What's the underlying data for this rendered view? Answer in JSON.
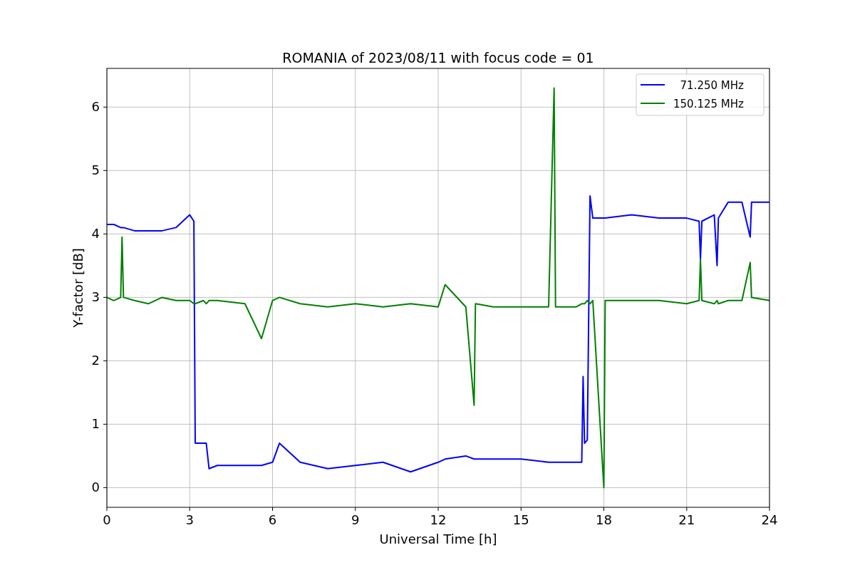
{
  "figure": {
    "chart_data": {
      "type": "line",
      "title": "ROMANIA of 2023/08/11 with focus code = 01",
      "xlabel": "Universal Time [h]",
      "ylabel": "Y-factor [dB]",
      "x": [
        0,
        0.25,
        0.5,
        0.55,
        0.6,
        1,
        1.5,
        2,
        2.5,
        3,
        3.15,
        3.2,
        3.5,
        3.6,
        3.7,
        4,
        5,
        5.6,
        6,
        6.25,
        7,
        8,
        9,
        10,
        11,
        12,
        12.25,
        13,
        13.3,
        13.35,
        14,
        15,
        16,
        16.2,
        16.25,
        17,
        17.2,
        17.25,
        17.3,
        17.4,
        17.5,
        17.6,
        18,
        18.05,
        19,
        20,
        21,
        21.45,
        21.5,
        21.55,
        22,
        22.1,
        22.15,
        22.5,
        23,
        23.3,
        23.35,
        24
      ],
      "series": [
        {
          "name": "  71.250 MHz",
          "color": "#0000ff",
          "values": [
            4.15,
            4.15,
            4.1,
            4.1,
            4.1,
            4.05,
            4.05,
            4.05,
            4.1,
            4.3,
            4.2,
            0.7,
            0.7,
            0.7,
            0.3,
            0.35,
            0.35,
            0.35,
            0.4,
            0.7,
            0.4,
            0.3,
            0.35,
            0.4,
            0.25,
            0.4,
            0.45,
            0.5,
            0.45,
            0.45,
            0.45,
            0.45,
            0.4,
            0.4,
            0.4,
            0.4,
            0.4,
            1.75,
            0.7,
            0.75,
            4.6,
            4.25,
            4.25,
            4.25,
            4.3,
            4.25,
            4.25,
            4.2,
            3.6,
            4.2,
            4.3,
            3.5,
            4.25,
            4.5,
            4.5,
            3.95,
            4.5,
            4.5
          ]
        },
        {
          "name": "150.125 MHz",
          "color": "#008000",
          "values": [
            3.0,
            2.95,
            3.0,
            3.95,
            3.0,
            2.95,
            2.9,
            3.0,
            2.95,
            2.95,
            2.9,
            2.9,
            2.95,
            2.9,
            2.95,
            2.95,
            2.9,
            2.35,
            2.95,
            3.0,
            2.9,
            2.85,
            2.9,
            2.85,
            2.9,
            2.85,
            3.2,
            2.85,
            1.3,
            2.9,
            2.85,
            2.85,
            2.85,
            6.3,
            2.85,
            2.85,
            2.9,
            2.9,
            2.9,
            2.95,
            2.9,
            2.95,
            0.0,
            2.95,
            2.95,
            2.95,
            2.9,
            2.95,
            3.6,
            2.95,
            2.9,
            2.95,
            2.9,
            2.95,
            2.95,
            3.55,
            3.0,
            2.95
          ]
        }
      ],
      "grid": true,
      "legend": "upper right",
      "xlim": [
        0,
        24
      ],
      "ylim": [
        -0.31,
        6.61
      ],
      "xticks": [
        0,
        3,
        6,
        9,
        12,
        15,
        18,
        21,
        24
      ],
      "yticks": [
        0,
        1,
        2,
        3,
        4,
        5,
        6
      ]
    }
  }
}
